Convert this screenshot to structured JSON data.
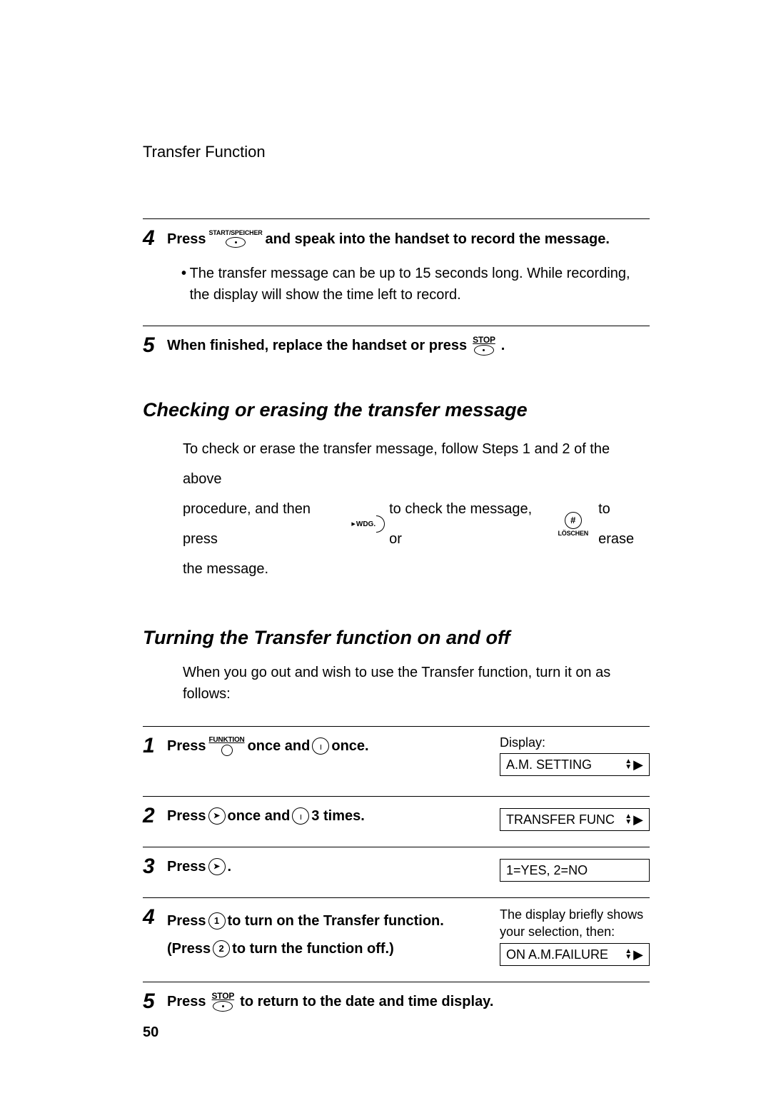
{
  "running_head": "Transfer Function",
  "upper_steps": {
    "s4": {
      "num": "4",
      "lead1": "Press",
      "key_label": "START/SPEICHER",
      "lead2": "and speak into the handset to record the message.",
      "bullet": "The transfer message can be up to 15 seconds long. While recording, the display will show the time left to record."
    },
    "s5": {
      "num": "5",
      "lead1": "When finished, replace the handset or press",
      "key_label": "STOP",
      "tail": "."
    }
  },
  "section_check_title": "Checking or erasing the transfer message",
  "check_para": {
    "p1": "To check or erase the transfer message, follow Steps 1 and 2 of the above",
    "p2a": "procedure, and then press",
    "wdg_label": "WDG.",
    "p2b": "to check the message, or",
    "hash": "#",
    "hash_label": "LÖSCHEN",
    "p2c": "to erase",
    "p3": "the message."
  },
  "section_turn_title": "Turning the Transfer function on and off",
  "turn_para": "When you go out and wish to use the Transfer function, turn it on as follows:",
  "steps": {
    "s1": {
      "num": "1",
      "a": "Press",
      "key_label": "FUNKTION",
      "b": "once and",
      "c": "once.",
      "disp_label": "Display:",
      "disp_value": "A.M. SETTING"
    },
    "s2": {
      "num": "2",
      "a": "Press",
      "b": "once and",
      "c": "3 times.",
      "disp_value": "TRANSFER FUNC"
    },
    "s3": {
      "num": "3",
      "a": "Press",
      "dot": ".",
      "disp_value": "1=YES, 2=NO"
    },
    "s4": {
      "num": "4",
      "a": "Press",
      "k1": "1",
      "b": "to turn on the Transfer function.",
      "c": "(Press",
      "k2": "2",
      "d": "to turn the function off.)",
      "note": "The display briefly shows your selection, then:",
      "disp_value": "ON A.M.FAILURE"
    },
    "s5": {
      "num": "5",
      "a": "Press",
      "key_label": "STOP",
      "b": "to return to the date and time display."
    }
  },
  "page_number": "50"
}
